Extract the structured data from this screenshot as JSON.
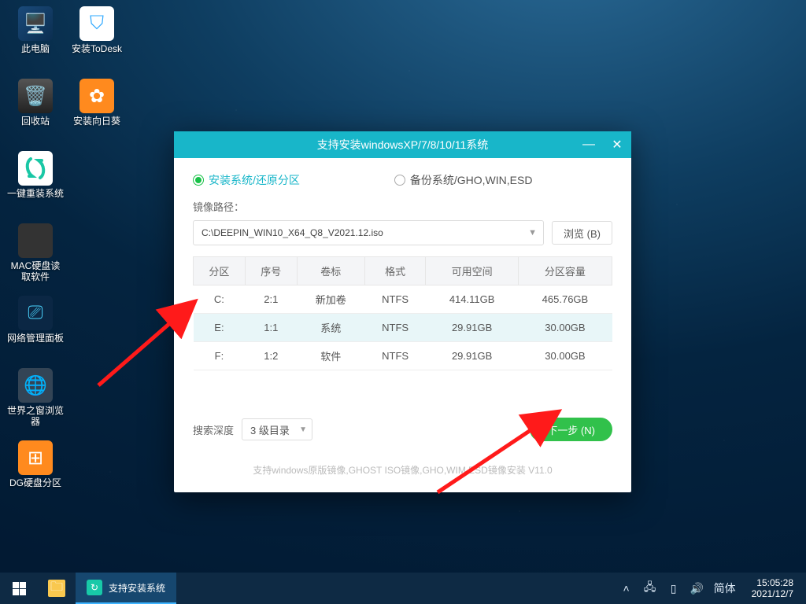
{
  "desktop": {
    "icons": [
      {
        "label": "此电脑"
      },
      {
        "label": "安装ToDesk"
      },
      {
        "label": "回收站"
      },
      {
        "label": "安装向日葵"
      },
      {
        "label": "一键重装系统"
      },
      {
        "label": "MAC硬盘读取软件"
      },
      {
        "label": "网络管理面板"
      },
      {
        "label": "世界之窗浏览器"
      },
      {
        "label": "DG硬盘分区"
      }
    ]
  },
  "dialog": {
    "title": "支持安装windowsXP/7/8/10/11系统",
    "radio_install": "安装系统/还原分区",
    "radio_backup": "备份系统/GHO,WIN,ESD",
    "image_path_label": "镜像路径：",
    "image_path_value": "C:\\DEEPIN_WIN10_X64_Q8_V2021.12.iso",
    "browse_btn": "浏览 (B)",
    "table": {
      "headers": [
        "分区",
        "序号",
        "卷标",
        "格式",
        "可用空间",
        "分区容量"
      ],
      "rows": [
        {
          "c": [
            "C:",
            "2:1",
            "新加卷",
            "NTFS",
            "414.11GB",
            "465.76GB"
          ],
          "selected": false
        },
        {
          "c": [
            "E:",
            "1:1",
            "系统",
            "NTFS",
            "29.91GB",
            "30.00GB"
          ],
          "selected": true
        },
        {
          "c": [
            "F:",
            "1:2",
            "软件",
            "NTFS",
            "29.91GB",
            "30.00GB"
          ],
          "selected": false
        }
      ]
    },
    "search_depth_label": "搜索深度",
    "search_depth_value": "3 级目录",
    "next_btn": "下一步 (N)",
    "footer": "支持windows原版镜像,GHOST ISO镜像,GHO,WIM,ESD镜像安装  V11.0"
  },
  "taskbar": {
    "task_label": "支持安装系统",
    "ime": "简体",
    "time": "15:05:28",
    "date": "2021/12/7"
  }
}
